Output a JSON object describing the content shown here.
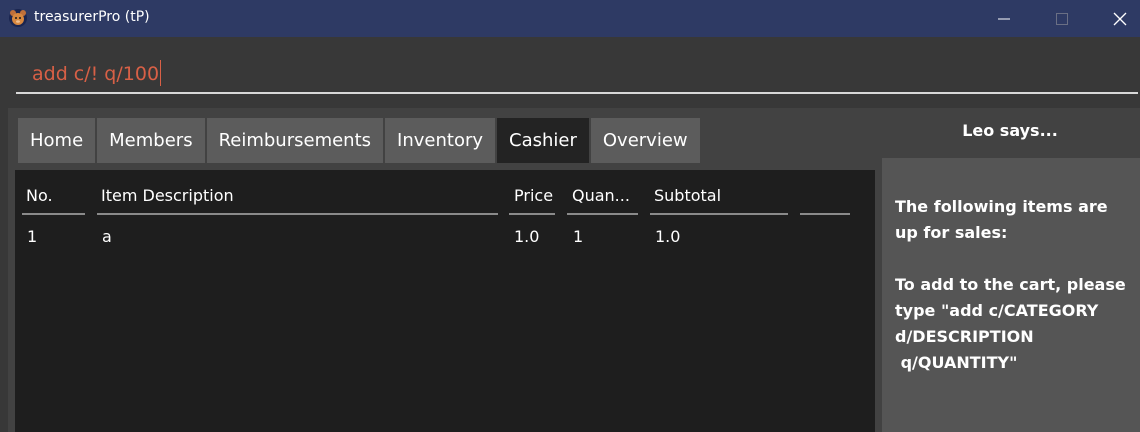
{
  "window": {
    "title": "treasurerPro (tP)",
    "minimize_glyph": "—",
    "maximize_glyph": "☐",
    "close_glyph": "✕"
  },
  "command": {
    "value": "add c/! q/100",
    "text_color": "#d86046"
  },
  "tabs": [
    {
      "label": "Home",
      "selected": false
    },
    {
      "label": "Members",
      "selected": false
    },
    {
      "label": "Reimbursements",
      "selected": false
    },
    {
      "label": "Inventory",
      "selected": false
    },
    {
      "label": "Cashier",
      "selected": true
    },
    {
      "label": "Overview",
      "selected": false
    }
  ],
  "table": {
    "columns": [
      "No.",
      "Item Description",
      "Price",
      "Quan...",
      "Subtotal",
      ""
    ],
    "rows": [
      {
        "no": "1",
        "description": "a",
        "price": "1.0",
        "quantity": "1",
        "subtotal": "1.0"
      }
    ]
  },
  "sidebar": {
    "title": "Leo says...",
    "message": "The following items are up for sales:\n\nTo add to the cart, please type \"add c/CATEGORY d/DESCRIPTION\n q/QUANTITY\""
  },
  "colors": {
    "titlebar": "#2e3a64",
    "background": "#383838",
    "tab": "#5c5c5c",
    "tab_selected": "#232323",
    "table_bg": "#1e1e1e",
    "side_panel": "#555555"
  },
  "icons": {
    "app": "bear-icon"
  }
}
